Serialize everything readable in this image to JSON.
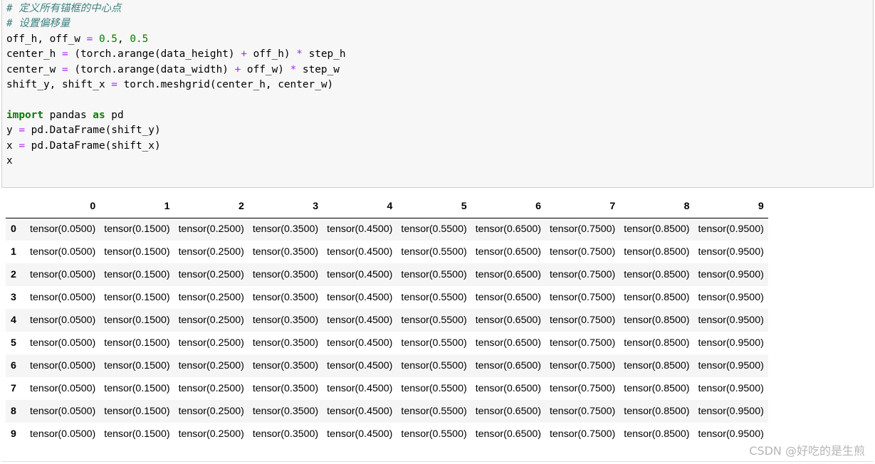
{
  "code_cell": {
    "lines": [
      [
        {
          "cls": "cm",
          "text": "# 定义所有锚框的中心点"
        }
      ],
      [
        {
          "cls": "cm",
          "text": "# 设置偏移量"
        }
      ],
      [
        {
          "cls": "",
          "text": "off_h, off_w "
        },
        {
          "cls": "op",
          "text": "="
        },
        {
          "cls": "",
          "text": " "
        },
        {
          "cls": "nm",
          "text": "0.5"
        },
        {
          "cls": "",
          "text": ", "
        },
        {
          "cls": "nm",
          "text": "0.5"
        }
      ],
      [
        {
          "cls": "",
          "text": "center_h "
        },
        {
          "cls": "op",
          "text": "="
        },
        {
          "cls": "",
          "text": " (torch.arange(data_height) "
        },
        {
          "cls": "op",
          "text": "+"
        },
        {
          "cls": "",
          "text": " off_h) "
        },
        {
          "cls": "op",
          "text": "*"
        },
        {
          "cls": "",
          "text": " step_h"
        }
      ],
      [
        {
          "cls": "",
          "text": "center_w "
        },
        {
          "cls": "op",
          "text": "="
        },
        {
          "cls": "",
          "text": " (torch.arange(data_width) "
        },
        {
          "cls": "op",
          "text": "+"
        },
        {
          "cls": "",
          "text": " off_w) "
        },
        {
          "cls": "op",
          "text": "*"
        },
        {
          "cls": "",
          "text": " step_w"
        }
      ],
      [
        {
          "cls": "",
          "text": "shift_y, shift_x "
        },
        {
          "cls": "op",
          "text": "="
        },
        {
          "cls": "",
          "text": " torch.meshgrid(center_h, center_w)"
        }
      ],
      [
        {
          "cls": "",
          "text": ""
        }
      ],
      [
        {
          "cls": "kw",
          "text": "import"
        },
        {
          "cls": "",
          "text": " pandas "
        },
        {
          "cls": "kw",
          "text": "as"
        },
        {
          "cls": "",
          "text": " pd"
        }
      ],
      [
        {
          "cls": "",
          "text": "y "
        },
        {
          "cls": "op",
          "text": "="
        },
        {
          "cls": "",
          "text": " pd.DataFrame(shift_y)"
        }
      ],
      [
        {
          "cls": "",
          "text": "x "
        },
        {
          "cls": "op",
          "text": "="
        },
        {
          "cls": "",
          "text": " pd.DataFrame(shift_x)"
        }
      ],
      [
        {
          "cls": "",
          "text": "x"
        }
      ]
    ]
  },
  "dataframe": {
    "columns": [
      "0",
      "1",
      "2",
      "3",
      "4",
      "5",
      "6",
      "7",
      "8",
      "9"
    ],
    "rows": [
      {
        "index": "0",
        "cells": [
          "tensor(0.0500)",
          "tensor(0.1500)",
          "tensor(0.2500)",
          "tensor(0.3500)",
          "tensor(0.4500)",
          "tensor(0.5500)",
          "tensor(0.6500)",
          "tensor(0.7500)",
          "tensor(0.8500)",
          "tensor(0.9500)"
        ]
      },
      {
        "index": "1",
        "cells": [
          "tensor(0.0500)",
          "tensor(0.1500)",
          "tensor(0.2500)",
          "tensor(0.3500)",
          "tensor(0.4500)",
          "tensor(0.5500)",
          "tensor(0.6500)",
          "tensor(0.7500)",
          "tensor(0.8500)",
          "tensor(0.9500)"
        ]
      },
      {
        "index": "2",
        "cells": [
          "tensor(0.0500)",
          "tensor(0.1500)",
          "tensor(0.2500)",
          "tensor(0.3500)",
          "tensor(0.4500)",
          "tensor(0.5500)",
          "tensor(0.6500)",
          "tensor(0.7500)",
          "tensor(0.8500)",
          "tensor(0.9500)"
        ]
      },
      {
        "index": "3",
        "cells": [
          "tensor(0.0500)",
          "tensor(0.1500)",
          "tensor(0.2500)",
          "tensor(0.3500)",
          "tensor(0.4500)",
          "tensor(0.5500)",
          "tensor(0.6500)",
          "tensor(0.7500)",
          "tensor(0.8500)",
          "tensor(0.9500)"
        ]
      },
      {
        "index": "4",
        "cells": [
          "tensor(0.0500)",
          "tensor(0.1500)",
          "tensor(0.2500)",
          "tensor(0.3500)",
          "tensor(0.4500)",
          "tensor(0.5500)",
          "tensor(0.6500)",
          "tensor(0.7500)",
          "tensor(0.8500)",
          "tensor(0.9500)"
        ]
      },
      {
        "index": "5",
        "cells": [
          "tensor(0.0500)",
          "tensor(0.1500)",
          "tensor(0.2500)",
          "tensor(0.3500)",
          "tensor(0.4500)",
          "tensor(0.5500)",
          "tensor(0.6500)",
          "tensor(0.7500)",
          "tensor(0.8500)",
          "tensor(0.9500)"
        ]
      },
      {
        "index": "6",
        "cells": [
          "tensor(0.0500)",
          "tensor(0.1500)",
          "tensor(0.2500)",
          "tensor(0.3500)",
          "tensor(0.4500)",
          "tensor(0.5500)",
          "tensor(0.6500)",
          "tensor(0.7500)",
          "tensor(0.8500)",
          "tensor(0.9500)"
        ]
      },
      {
        "index": "7",
        "cells": [
          "tensor(0.0500)",
          "tensor(0.1500)",
          "tensor(0.2500)",
          "tensor(0.3500)",
          "tensor(0.4500)",
          "tensor(0.5500)",
          "tensor(0.6500)",
          "tensor(0.7500)",
          "tensor(0.8500)",
          "tensor(0.9500)"
        ]
      },
      {
        "index": "8",
        "cells": [
          "tensor(0.0500)",
          "tensor(0.1500)",
          "tensor(0.2500)",
          "tensor(0.3500)",
          "tensor(0.4500)",
          "tensor(0.5500)",
          "tensor(0.6500)",
          "tensor(0.7500)",
          "tensor(0.8500)",
          "tensor(0.9500)"
        ]
      },
      {
        "index": "9",
        "cells": [
          "tensor(0.0500)",
          "tensor(0.1500)",
          "tensor(0.2500)",
          "tensor(0.3500)",
          "tensor(0.4500)",
          "tensor(0.5500)",
          "tensor(0.6500)",
          "tensor(0.7500)",
          "tensor(0.8500)",
          "tensor(0.9500)"
        ]
      }
    ]
  },
  "watermark": {
    "text": "CSDN @好吃的是生煎"
  },
  "colors": {
    "comment": "#408080",
    "keyword": "#008000",
    "number": "#008000",
    "operator": "#aa22ff",
    "cell_background": "#f7f7f7",
    "stripe_row": "#f5f5f5"
  }
}
